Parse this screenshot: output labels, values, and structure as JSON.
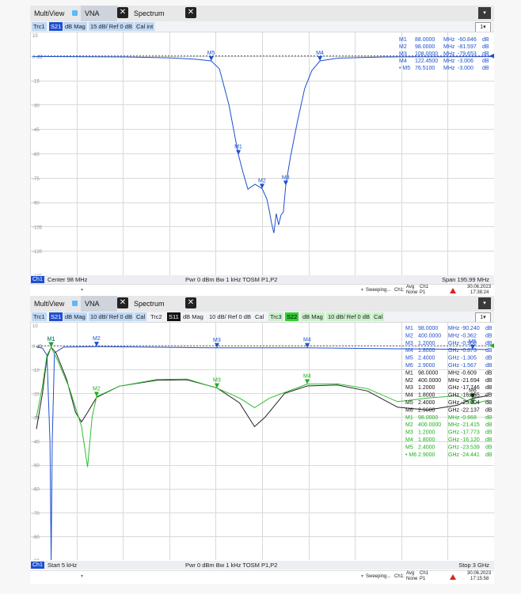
{
  "top": {
    "tabs": [
      {
        "label": "MultiView"
      },
      {
        "label": "VNA"
      },
      {
        "label": "Spectrum"
      }
    ],
    "close_glyph": "✕",
    "menu_glyph": "▾",
    "traces": [
      {
        "label": "Trc1"
      },
      {
        "label": "S21"
      },
      {
        "label": "dB Mag"
      },
      {
        "label": "15 dB/ Ref 0 dB"
      },
      {
        "label": "Cal int"
      }
    ],
    "layout_badge": "1▾",
    "y_ticks": [
      "15",
      "0 dB",
      "-15",
      "-30",
      "-45",
      "-60",
      "-75",
      "-90",
      "-105",
      "-120",
      "-135"
    ],
    "markers": [
      {
        "name": "M1",
        "freq": "88.0000",
        "unit": "MHz",
        "value": "-60.846",
        "vunit": "dB"
      },
      {
        "name": "M2",
        "freq": "98.0000",
        "unit": "MHz",
        "value": "-81.597",
        "vunit": "dB"
      },
      {
        "name": "M3",
        "freq": "108.0000",
        "unit": "MHz",
        "value": "-79.653",
        "vunit": "dB"
      },
      {
        "name": "M4",
        "freq": "122.4500",
        "unit": "MHz",
        "value": "-3.006",
        "vunit": "dB"
      },
      {
        "name": "• M5",
        "freq": "76.5100",
        "unit": "MHz",
        "value": "-3.000",
        "vunit": "dB"
      }
    ],
    "status": {
      "channel": "Ch1",
      "center": "Center  98 MHz",
      "pwr": "Pwr  0 dBm   Bw   1 kHz   TOSM P1,P2",
      "span": "Span   195.99 MHz"
    },
    "footer": {
      "sweep": "Sweeping...",
      "ch": "Ch1:",
      "avg": "Avg",
      "none": "None",
      "ch1": "Ch1",
      "p1": "P1",
      "date": "30.06.2023",
      "time": "17:38:24"
    }
  },
  "bottom": {
    "tabs": [
      {
        "label": "MultiView"
      },
      {
        "label": "VNA"
      },
      {
        "label": "Spectrum"
      }
    ],
    "traces": [
      {
        "label": "Trc1"
      },
      {
        "label": "S21"
      },
      {
        "label": "dB Mag"
      },
      {
        "label": "10 dB/ Ref 0 dB"
      },
      {
        "label": "Cal"
      },
      {
        "label": "Trc2"
      },
      {
        "label": "S11"
      },
      {
        "label": "dB Mag"
      },
      {
        "label": "10 dB/ Ref 0 dB"
      },
      {
        "label": "Cal"
      },
      {
        "label": "Trc3"
      },
      {
        "label": "S22"
      },
      {
        "label": "dB Mag"
      },
      {
        "label": "10 dB/ Ref 0 dB"
      },
      {
        "label": "Cal"
      }
    ],
    "layout_badge": "1▾",
    "y_ticks": [
      "10",
      "0 dB",
      "-10",
      "-20",
      "-30",
      "-40",
      "-50",
      "-60",
      "-70",
      "-80",
      "-90"
    ],
    "marker_groups": [
      {
        "color": "#1d4fd0",
        "rows": [
          {
            "name": "M1",
            "freq": "98.0000",
            "unit": "MHz",
            "value": "-90.240",
            "vunit": "dB"
          },
          {
            "name": "M2",
            "freq": "400.0000",
            "unit": "MHz",
            "value": "-0.362",
            "vunit": "dB"
          },
          {
            "name": "M3",
            "freq": "1.2000",
            "unit": "GHz",
            "value": "-0.906",
            "vunit": "dB"
          },
          {
            "name": "M4",
            "freq": "1.8000",
            "unit": "GHz",
            "value": "-0.873",
            "vunit": "dB"
          },
          {
            "name": "M5",
            "freq": "2.4000",
            "unit": "GHz",
            "value": "-1.305",
            "vunit": "dB"
          },
          {
            "name": "M6",
            "freq": "2.9000",
            "unit": "GHz",
            "value": "-1.567",
            "vunit": "dB"
          }
        ]
      },
      {
        "color": "#111111",
        "rows": [
          {
            "name": "M1",
            "freq": "98.0000",
            "unit": "MHz",
            "value": "-0.609",
            "vunit": "dB"
          },
          {
            "name": "M2",
            "freq": "400.0000",
            "unit": "MHz",
            "value": "-21.694",
            "vunit": "dB"
          },
          {
            "name": "M3",
            "freq": "1.2000",
            "unit": "GHz",
            "value": "-17.746",
            "vunit": "dB"
          },
          {
            "name": "M4",
            "freq": "1.8000",
            "unit": "GHz",
            "value": "-16.855",
            "vunit": "dB"
          },
          {
            "name": "M5",
            "freq": "2.4000",
            "unit": "GHz",
            "value": "-25.804",
            "vunit": "dB"
          },
          {
            "name": "M6",
            "freq": "2.9000",
            "unit": "GHz",
            "value": "-22.137",
            "vunit": "dB"
          }
        ]
      },
      {
        "color": "#1fae1f",
        "rows": [
          {
            "name": "M1",
            "freq": "98.0000",
            "unit": "MHz",
            "value": "-0.668",
            "vunit": "dB"
          },
          {
            "name": "M2",
            "freq": "400.0000",
            "unit": "MHz",
            "value": "-21.415",
            "vunit": "dB"
          },
          {
            "name": "M3",
            "freq": "1.2000",
            "unit": "GHz",
            "value": "-17.773",
            "vunit": "dB"
          },
          {
            "name": "M4",
            "freq": "1.8000",
            "unit": "GHz",
            "value": "-16.120",
            "vunit": "dB"
          },
          {
            "name": "M5",
            "freq": "2.4000",
            "unit": "GHz",
            "value": "-23.539",
            "vunit": "dB"
          },
          {
            "name": "• M6",
            "freq": "2.9000",
            "unit": "GHz",
            "value": "-24.441",
            "vunit": "dB"
          }
        ]
      }
    ],
    "status": {
      "channel": "Ch1",
      "start": "Start  5 kHz",
      "pwr": "Pwr  0 dBm   Bw   1 kHz   TOSM P1,P2",
      "stop": "Stop   3 GHz"
    },
    "footer": {
      "sweep": "Sweeping...",
      "ch": "Ch1:",
      "avg": "Avg",
      "none": "None",
      "ch1": "Ch1",
      "p1": "P1",
      "date": "30.06.2023",
      "time": "17:15:58"
    }
  },
  "colors": {
    "s21": "#1d4fd0",
    "s11": "#222222",
    "s22": "#2fbe2f",
    "grid": "#d9d9d9"
  }
}
